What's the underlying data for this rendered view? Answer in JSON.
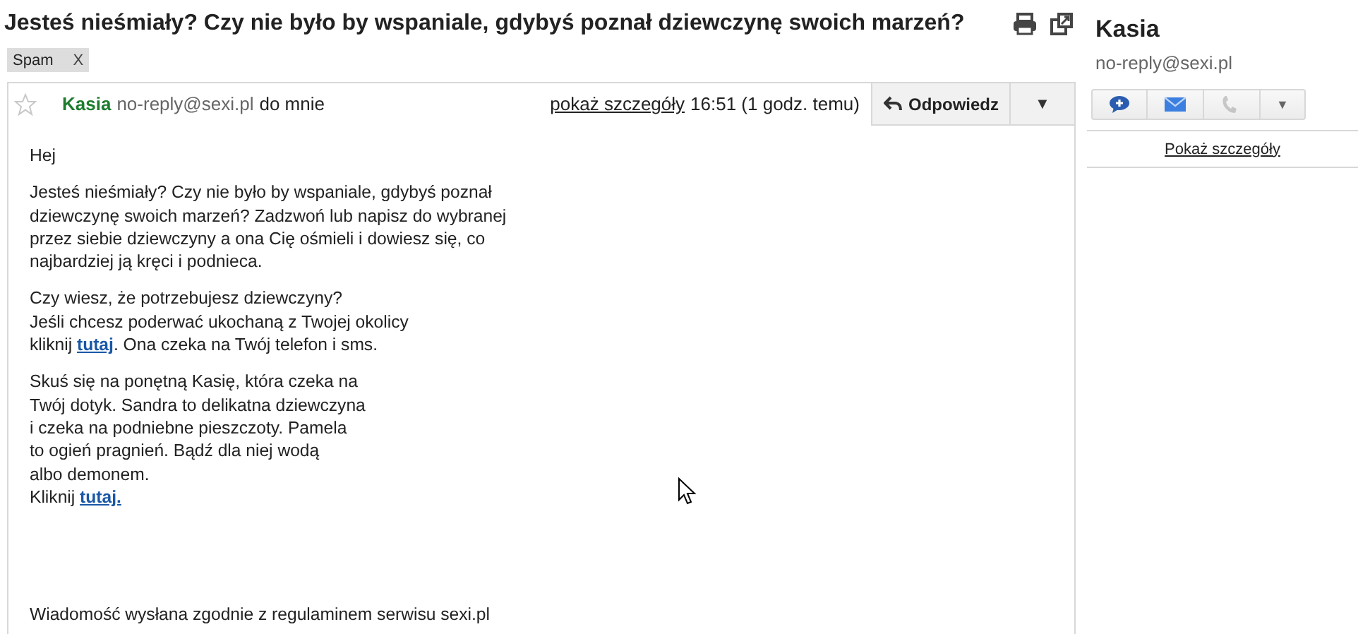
{
  "subject": "Jesteś nieśmiały? Czy nie było by wspaniale, gdybyś poznał dziewczynę swoich marzeń?",
  "labels": [
    {
      "text": "Spam",
      "remove": "X"
    }
  ],
  "message": {
    "starred": false,
    "sender_name": "Kasia",
    "sender_email": "no-reply@sexi.pl",
    "recipient": "do mnie",
    "details_link": "pokaż szczegóły",
    "time": "16:51 (1 godz. temu)",
    "reply_button": "Odpowiedz",
    "more_button": "▼",
    "paragraphs": [
      {
        "lines": [
          [
            {
              "kind": "text",
              "text": "Hej"
            }
          ]
        ]
      },
      {
        "lines": [
          [
            {
              "kind": "text",
              "text": "Jesteś nieśmiały? Czy nie było by wspaniale, gdybyś poznał"
            }
          ],
          [
            {
              "kind": "text",
              "text": "dziewczynę swoich marzeń? Zadzwoń lub napisz do wybranej"
            }
          ],
          [
            {
              "kind": "text",
              "text": "przez siebie dziewczyny a ona Cię ośmieli i dowiesz się, co"
            }
          ],
          [
            {
              "kind": "text",
              "text": "najbardziej ją kręci i podnieca."
            }
          ]
        ]
      },
      {
        "lines": [
          [
            {
              "kind": "text",
              "text": "Czy wiesz, że potrzebujesz dziewczyny?"
            }
          ],
          [
            {
              "kind": "text",
              "text": "Jeśli chcesz poderwać ukochaną z Twojej okolicy"
            }
          ],
          [
            {
              "kind": "text",
              "text": "kliknij "
            },
            {
              "kind": "link",
              "text": "tutaj"
            },
            {
              "kind": "text",
              "text": ". Ona czeka na Twój telefon i sms."
            }
          ]
        ]
      },
      {
        "lines": [
          [
            {
              "kind": "text",
              "text": "Skuś się na ponętną Kasię, która czeka na"
            }
          ],
          [
            {
              "kind": "text",
              "text": "Twój dotyk. Sandra to delikatna dziewczyna"
            }
          ],
          [
            {
              "kind": "text",
              "text": "i czeka na podniebne pieszczoty. Pamela"
            }
          ],
          [
            {
              "kind": "text",
              "text": "to ogień pragnień. Bądź dla niej wodą"
            }
          ],
          [
            {
              "kind": "text",
              "text": "albo demonem."
            }
          ],
          [
            {
              "kind": "text",
              "text": "Kliknij "
            },
            {
              "kind": "link",
              "text": "tutaj."
            }
          ]
        ]
      }
    ],
    "footer": "Wiadomość wysłana zgodnie z regulaminem serwisu sexi.pl"
  },
  "contact": {
    "name": "Kasia",
    "email": "no-reply@sexi.pl",
    "actions": [
      {
        "kind": "chat",
        "disabled": false
      },
      {
        "kind": "mail",
        "disabled": false
      },
      {
        "kind": "phone",
        "disabled": true
      },
      {
        "kind": "more",
        "text": "▼",
        "disabled": false
      }
    ],
    "details_link": "Pokaż szczegóły"
  }
}
